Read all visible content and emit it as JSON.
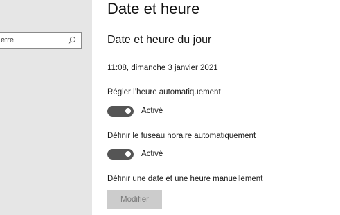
{
  "sidebar": {
    "search": {
      "value": "ètre",
      "icon": "search-icon"
    }
  },
  "main": {
    "title": "Date et heure",
    "section_title": "Date et heure du jour",
    "current_datetime": "11:08, dimanche 3 janvier 2021",
    "settings": [
      {
        "label": "Régler l’heure automatiquement",
        "state_label": "Activé",
        "on": true
      },
      {
        "label": "Définir le fuseau horaire automatiquement",
        "state_label": "Activé",
        "on": true
      }
    ],
    "manual": {
      "label": "Définir une date et une heure manuellement",
      "button_label": "Modifier",
      "button_enabled": false
    }
  },
  "colors": {
    "sidebar_bg": "#e6e6e6",
    "toggle_on": "#555555",
    "button_disabled_bg": "#cccccc",
    "button_disabled_text": "#7a7a7a"
  }
}
